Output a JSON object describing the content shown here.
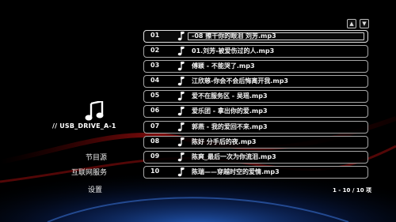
{
  "device": {
    "label": "// USB_DRIVE_A-1"
  },
  "menu": {
    "items": [
      {
        "label": "节目源"
      },
      {
        "label": "互联网服务"
      },
      {
        "label": "设置"
      }
    ]
  },
  "scroll": {
    "up_icon": "chevron-up-icon",
    "down_icon": "chevron-down-icon"
  },
  "tracks": [
    {
      "num": "01",
      "title": "-08 擦干你的眼泪 刘芳.mp3",
      "selected": true
    },
    {
      "num": "02",
      "title": "01.刘芳-被爱伤过的人.mp3"
    },
    {
      "num": "03",
      "title": "傅颖 - 不能哭了.mp3"
    },
    {
      "num": "04",
      "title": "江欣慈-你会不会后悔离开我.mp3"
    },
    {
      "num": "05",
      "title": "爱不在服务区 - 吴瑶.mp3"
    },
    {
      "num": "06",
      "title": "爱乐团 - 拿出你的爱.mp3"
    },
    {
      "num": "07",
      "title": "郭燕 - 我的爱回不来.mp3"
    },
    {
      "num": "08",
      "title": "陈好 分手后的夜.mp3"
    },
    {
      "num": "09",
      "title": "陈爽_最后一次为你流泪.mp3"
    },
    {
      "num": "10",
      "title": "陈瑞——穿越时空的爱情.mp3"
    }
  ],
  "pagination": {
    "text": "1 - 10 / 10 项"
  },
  "colors": {
    "accent_red": "#c0181a",
    "accent_blue": "#1d4fb0",
    "row_border": "#a8a8a8"
  }
}
